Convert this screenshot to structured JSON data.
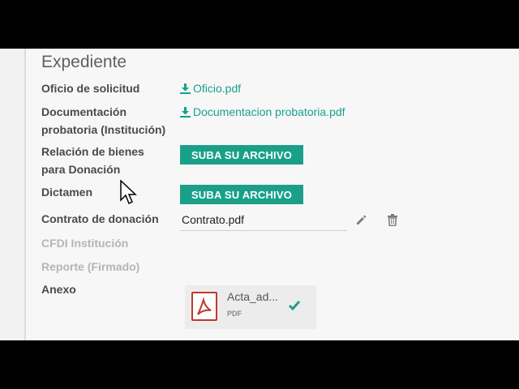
{
  "section": {
    "title": "Expediente"
  },
  "rows": {
    "oficio": {
      "label": "Oficio de solicitud",
      "file": "Oficio.pdf"
    },
    "documentacion": {
      "label_line1": "Documentación",
      "label_line2": "probatoria (Institución)",
      "file": "Documentacion probatoria.pdf"
    },
    "relacion": {
      "label_line1": "Relación de bienes",
      "label_line2": "para Donación",
      "button": "SUBA SU ARCHIVO"
    },
    "dictamen": {
      "label": "Dictamen",
      "button": "SUBA SU ARCHIVO"
    },
    "contrato": {
      "label": "Contrato de donación",
      "file": "Contrato.pdf"
    },
    "cfdi": {
      "label": "CFDI Institución"
    },
    "reporte": {
      "label": "Reporte (Firmado)"
    },
    "anexo": {
      "label": "Anexo",
      "attachment_name": "Acta_ad...",
      "attachment_type": "PDF"
    }
  },
  "colors": {
    "accent": "#1aa089",
    "link": "#17a08d",
    "muted": "#b5b5b5",
    "pdf_red": "#c0392b"
  },
  "icons": [
    "download-icon",
    "pencil-icon",
    "trash-icon",
    "pdf-icon",
    "check-icon",
    "mouse-cursor-icon"
  ]
}
